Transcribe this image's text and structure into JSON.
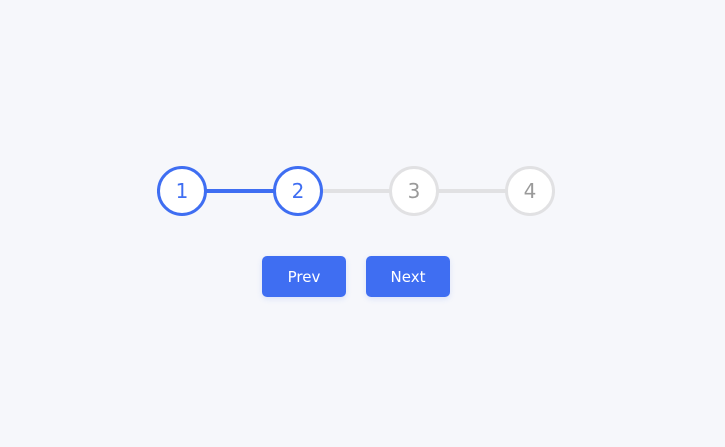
{
  "stepper": {
    "steps": [
      {
        "label": "1",
        "active": true
      },
      {
        "label": "2",
        "active": true
      },
      {
        "label": "3",
        "active": false
      },
      {
        "label": "4",
        "active": false
      }
    ],
    "current_step": 2,
    "progress_fraction": 0.3333
  },
  "buttons": {
    "prev_label": "Prev",
    "next_label": "Next"
  },
  "colors": {
    "accent": "#3f6ef2",
    "inactive": "#e1e1e3",
    "background": "#f6f7fb"
  }
}
